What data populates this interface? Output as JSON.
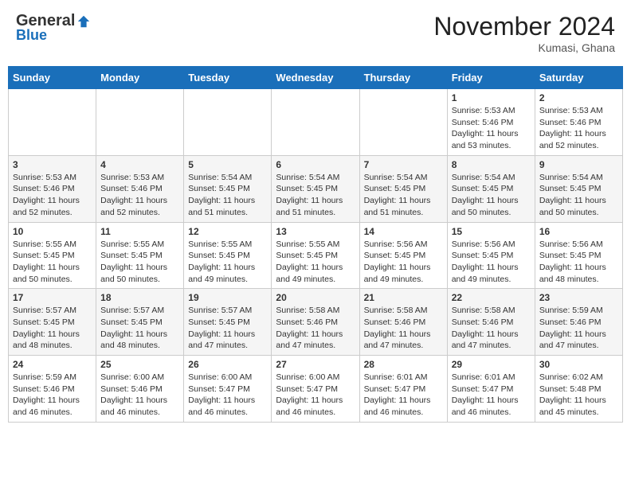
{
  "header": {
    "logo_general": "General",
    "logo_blue": "Blue",
    "month_title": "November 2024",
    "location": "Kumasi, Ghana"
  },
  "days_of_week": [
    "Sunday",
    "Monday",
    "Tuesday",
    "Wednesday",
    "Thursday",
    "Friday",
    "Saturday"
  ],
  "weeks": [
    [
      {
        "day": "",
        "info": ""
      },
      {
        "day": "",
        "info": ""
      },
      {
        "day": "",
        "info": ""
      },
      {
        "day": "",
        "info": ""
      },
      {
        "day": "",
        "info": ""
      },
      {
        "day": "1",
        "info": "Sunrise: 5:53 AM\nSunset: 5:46 PM\nDaylight: 11 hours\nand 53 minutes."
      },
      {
        "day": "2",
        "info": "Sunrise: 5:53 AM\nSunset: 5:46 PM\nDaylight: 11 hours\nand 52 minutes."
      }
    ],
    [
      {
        "day": "3",
        "info": "Sunrise: 5:53 AM\nSunset: 5:46 PM\nDaylight: 11 hours\nand 52 minutes."
      },
      {
        "day": "4",
        "info": "Sunrise: 5:53 AM\nSunset: 5:46 PM\nDaylight: 11 hours\nand 52 minutes."
      },
      {
        "day": "5",
        "info": "Sunrise: 5:54 AM\nSunset: 5:45 PM\nDaylight: 11 hours\nand 51 minutes."
      },
      {
        "day": "6",
        "info": "Sunrise: 5:54 AM\nSunset: 5:45 PM\nDaylight: 11 hours\nand 51 minutes."
      },
      {
        "day": "7",
        "info": "Sunrise: 5:54 AM\nSunset: 5:45 PM\nDaylight: 11 hours\nand 51 minutes."
      },
      {
        "day": "8",
        "info": "Sunrise: 5:54 AM\nSunset: 5:45 PM\nDaylight: 11 hours\nand 50 minutes."
      },
      {
        "day": "9",
        "info": "Sunrise: 5:54 AM\nSunset: 5:45 PM\nDaylight: 11 hours\nand 50 minutes."
      }
    ],
    [
      {
        "day": "10",
        "info": "Sunrise: 5:55 AM\nSunset: 5:45 PM\nDaylight: 11 hours\nand 50 minutes."
      },
      {
        "day": "11",
        "info": "Sunrise: 5:55 AM\nSunset: 5:45 PM\nDaylight: 11 hours\nand 50 minutes."
      },
      {
        "day": "12",
        "info": "Sunrise: 5:55 AM\nSunset: 5:45 PM\nDaylight: 11 hours\nand 49 minutes."
      },
      {
        "day": "13",
        "info": "Sunrise: 5:55 AM\nSunset: 5:45 PM\nDaylight: 11 hours\nand 49 minutes."
      },
      {
        "day": "14",
        "info": "Sunrise: 5:56 AM\nSunset: 5:45 PM\nDaylight: 11 hours\nand 49 minutes."
      },
      {
        "day": "15",
        "info": "Sunrise: 5:56 AM\nSunset: 5:45 PM\nDaylight: 11 hours\nand 49 minutes."
      },
      {
        "day": "16",
        "info": "Sunrise: 5:56 AM\nSunset: 5:45 PM\nDaylight: 11 hours\nand 48 minutes."
      }
    ],
    [
      {
        "day": "17",
        "info": "Sunrise: 5:57 AM\nSunset: 5:45 PM\nDaylight: 11 hours\nand 48 minutes."
      },
      {
        "day": "18",
        "info": "Sunrise: 5:57 AM\nSunset: 5:45 PM\nDaylight: 11 hours\nand 48 minutes."
      },
      {
        "day": "19",
        "info": "Sunrise: 5:57 AM\nSunset: 5:45 PM\nDaylight: 11 hours\nand 47 minutes."
      },
      {
        "day": "20",
        "info": "Sunrise: 5:58 AM\nSunset: 5:46 PM\nDaylight: 11 hours\nand 47 minutes."
      },
      {
        "day": "21",
        "info": "Sunrise: 5:58 AM\nSunset: 5:46 PM\nDaylight: 11 hours\nand 47 minutes."
      },
      {
        "day": "22",
        "info": "Sunrise: 5:58 AM\nSunset: 5:46 PM\nDaylight: 11 hours\nand 47 minutes."
      },
      {
        "day": "23",
        "info": "Sunrise: 5:59 AM\nSunset: 5:46 PM\nDaylight: 11 hours\nand 47 minutes."
      }
    ],
    [
      {
        "day": "24",
        "info": "Sunrise: 5:59 AM\nSunset: 5:46 PM\nDaylight: 11 hours\nand 46 minutes."
      },
      {
        "day": "25",
        "info": "Sunrise: 6:00 AM\nSunset: 5:46 PM\nDaylight: 11 hours\nand 46 minutes."
      },
      {
        "day": "26",
        "info": "Sunrise: 6:00 AM\nSunset: 5:47 PM\nDaylight: 11 hours\nand 46 minutes."
      },
      {
        "day": "27",
        "info": "Sunrise: 6:00 AM\nSunset: 5:47 PM\nDaylight: 11 hours\nand 46 minutes."
      },
      {
        "day": "28",
        "info": "Sunrise: 6:01 AM\nSunset: 5:47 PM\nDaylight: 11 hours\nand 46 minutes."
      },
      {
        "day": "29",
        "info": "Sunrise: 6:01 AM\nSunset: 5:47 PM\nDaylight: 11 hours\nand 46 minutes."
      },
      {
        "day": "30",
        "info": "Sunrise: 6:02 AM\nSunset: 5:48 PM\nDaylight: 11 hours\nand 45 minutes."
      }
    ]
  ]
}
